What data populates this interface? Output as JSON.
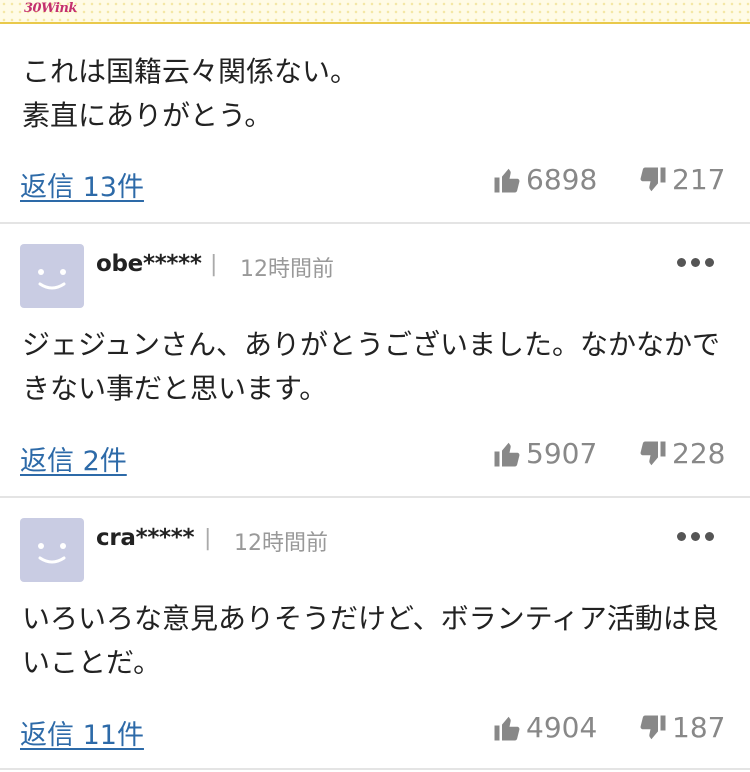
{
  "header": {
    "logo_text": "30Wink"
  },
  "comments": [
    {
      "username": "",
      "time": "",
      "body": "これは国籍云々関係ない。\n素直にありがとう。",
      "reply_label": "返信 13件",
      "likes": "6898",
      "dislikes": "217"
    },
    {
      "username": "obe*****",
      "time": "12時間前",
      "body": "ジェジュンさん、ありがとうございました。なかなかできない事だと思います。",
      "reply_label": "返信 2件",
      "likes": "5907",
      "dislikes": "228"
    },
    {
      "username": "cra*****",
      "time": "12時間前",
      "body": "いろいろな意見ありそうだけど、ボランティア活動は良いことだ。",
      "reply_label": "返信 11件",
      "likes": "4904",
      "dislikes": "187"
    }
  ],
  "icons": {
    "like": "thumbs-up-icon",
    "dislike": "thumbs-down-icon",
    "more": "more-options-icon",
    "avatar": "smiley-avatar-icon"
  },
  "colors": {
    "link": "#2d6aa8",
    "avatar_bg": "#c9cce3",
    "meta": "#999999"
  }
}
